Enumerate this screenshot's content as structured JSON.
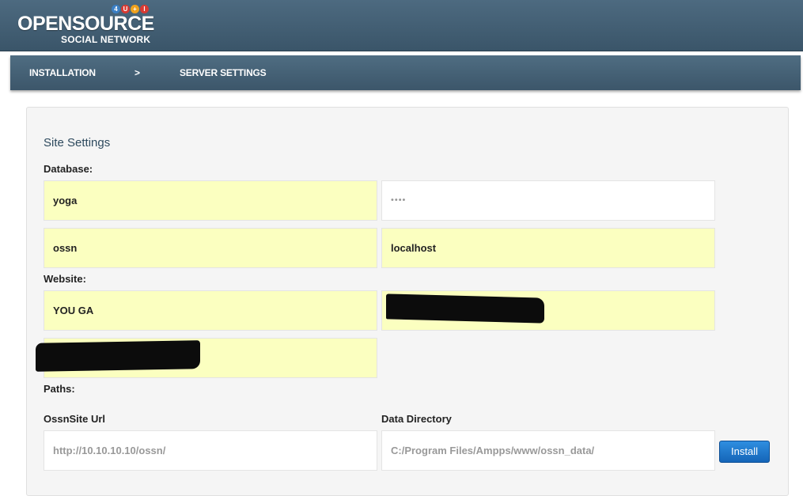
{
  "header": {
    "logo_main": "OPENSOURCE",
    "logo_sub": "SOCIAL NETWORK",
    "logo_badges": [
      "4",
      "U",
      "+",
      "I"
    ]
  },
  "breadcrumb": {
    "step1": "INSTALLATION",
    "separator": ">",
    "step2": "SERVER SETTINGS"
  },
  "form": {
    "title": "Site Settings",
    "database_label": "Database:",
    "db_user": "yoga",
    "db_password": "••••",
    "db_name": "ossn",
    "db_host": "localhost",
    "website_label": "Website:",
    "site_name": "YOU GA",
    "paths_label": "Paths:",
    "url_label": "OssnSite Url",
    "url_value": "http://10.10.10.10/ossn/",
    "datadir_label": "Data Directory",
    "datadir_value": "C:/Program Files/Ampps/www/ossn_data/",
    "install_button": "Install"
  },
  "colors": {
    "header": "#3f5a6e",
    "field_autofill": "#fbffc0",
    "button": "#1e77d0"
  }
}
